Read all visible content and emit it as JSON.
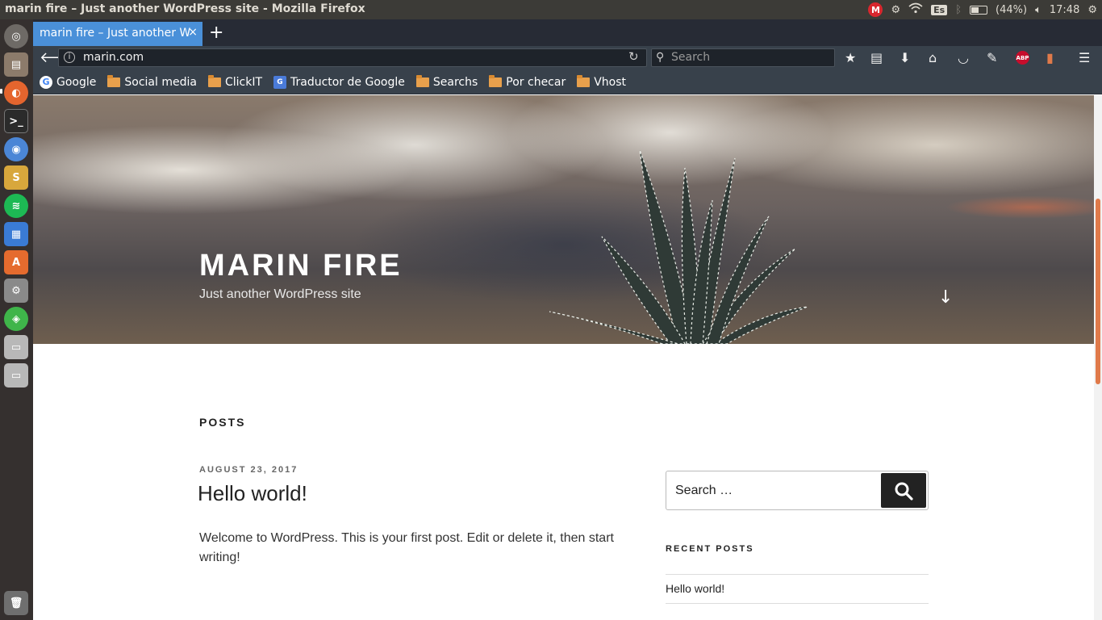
{
  "system": {
    "window_title": "marin fire – Just another WordPress site - Mozilla Firefox",
    "battery": "(44%)",
    "clock": "17:48",
    "keyboard_layout": "Es",
    "mega_label": "M"
  },
  "launcher": {
    "items": [
      "dash",
      "files",
      "firefox",
      "terminal",
      "chromium",
      "slack",
      "spotify",
      "libreoffice-writer",
      "software-center",
      "system-settings",
      "green-app",
      "drive-1",
      "drive-2",
      "trash"
    ]
  },
  "browser": {
    "tab_title": "marin fire – Just another W",
    "tab_close": "×",
    "new_tab": "+",
    "url": "marin.com",
    "search_placeholder": "Search",
    "abp_label": "ABP",
    "bookmarks": [
      {
        "label": "Google",
        "icon": "google-icon"
      },
      {
        "label": "Social media",
        "icon": "folder-icon"
      },
      {
        "label": "ClickIT",
        "icon": "folder-icon"
      },
      {
        "label": "Traductor de Google",
        "icon": "google-translate-icon"
      },
      {
        "label": "Searchs",
        "icon": "folder-icon"
      },
      {
        "label": "Por checar",
        "icon": "folder-icon"
      },
      {
        "label": "Vhost",
        "icon": "folder-icon"
      }
    ]
  },
  "page": {
    "site_title": "MARIN FIRE",
    "tagline": "Just another WordPress site",
    "posts_heading": "POSTS",
    "post": {
      "date": "AUGUST 23, 2017",
      "title": "Hello world!",
      "excerpt": "Welcome to WordPress. This is your first post. Edit or delete it, then start writing!"
    },
    "sidebar": {
      "search_placeholder": "Search …",
      "recent_heading": "RECENT POSTS",
      "recent_posts": [
        "Hello world!"
      ]
    }
  },
  "colors": {
    "top_panel": "#3c3b37",
    "launcher": "#35302f",
    "tab_active": "#4a90d9",
    "toolbar": "#38414b",
    "scroll_thumb": "#e07a4a"
  }
}
